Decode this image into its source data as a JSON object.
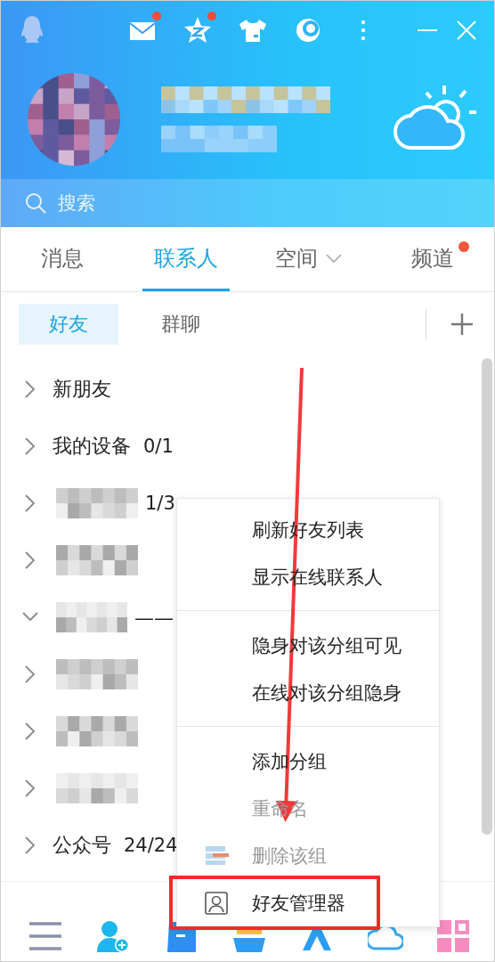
{
  "title_bar": {
    "icons": [
      {
        "kind": "mail",
        "badge": true
      },
      {
        "kind": "star",
        "badge": true
      },
      {
        "kind": "shirt",
        "badge": false
      },
      {
        "kind": "moon",
        "badge": false
      },
      {
        "kind": "more",
        "badge": false
      }
    ]
  },
  "search": {
    "placeholder": "搜索"
  },
  "tabs": [
    {
      "label": "消息",
      "selected": false,
      "dropdown": false,
      "badge": false
    },
    {
      "label": "联系人",
      "selected": true,
      "dropdown": false,
      "badge": false
    },
    {
      "label": "空间",
      "selected": false,
      "dropdown": true,
      "badge": false
    },
    {
      "label": "频道",
      "selected": false,
      "dropdown": false,
      "badge": true
    }
  ],
  "subtabs": [
    {
      "label": "好友",
      "selected": true
    },
    {
      "label": "群聊",
      "selected": false
    }
  ],
  "groups": [
    {
      "kind": "plain",
      "name": "新朋友",
      "expanded": false
    },
    {
      "kind": "plain",
      "name": "我的设备",
      "count": "0/1",
      "expanded": false
    },
    {
      "kind": "blurred",
      "count": "1/3",
      "expanded": false
    },
    {
      "kind": "blurred",
      "expanded": false
    },
    {
      "kind": "blurred",
      "name_tail": "——",
      "expanded": true
    },
    {
      "kind": "blurred",
      "expanded": false
    },
    {
      "kind": "blurred",
      "expanded": false
    },
    {
      "kind": "blurred",
      "expanded": false
    },
    {
      "kind": "plain",
      "name": "公众号",
      "count": "24/24",
      "expanded": false
    }
  ],
  "context_menu": [
    [
      {
        "kind": "text",
        "label": "刷新好友列表",
        "disabled": false
      },
      {
        "kind": "text",
        "label": "显示在线联系人",
        "disabled": false
      }
    ],
    [
      {
        "kind": "text",
        "label": "隐身对该分组可见",
        "disabled": false
      },
      {
        "kind": "text",
        "label": "在线对该分组隐身",
        "disabled": false
      }
    ],
    [
      {
        "kind": "text",
        "label": "添加分组",
        "disabled": false
      },
      {
        "kind": "text",
        "label": "重命名",
        "disabled": true
      },
      {
        "kind": "group",
        "label": "删除该组",
        "disabled": true
      },
      {
        "kind": "person",
        "label": "好友管理器",
        "disabled": false,
        "highlighted": true
      }
    ]
  ],
  "bottom_bar": [
    {
      "kind": "menu"
    },
    {
      "kind": "add-contact"
    },
    {
      "kind": "file"
    },
    {
      "kind": "game"
    },
    {
      "kind": "pen"
    },
    {
      "kind": "cloud"
    },
    {
      "kind": "apps"
    }
  ]
}
